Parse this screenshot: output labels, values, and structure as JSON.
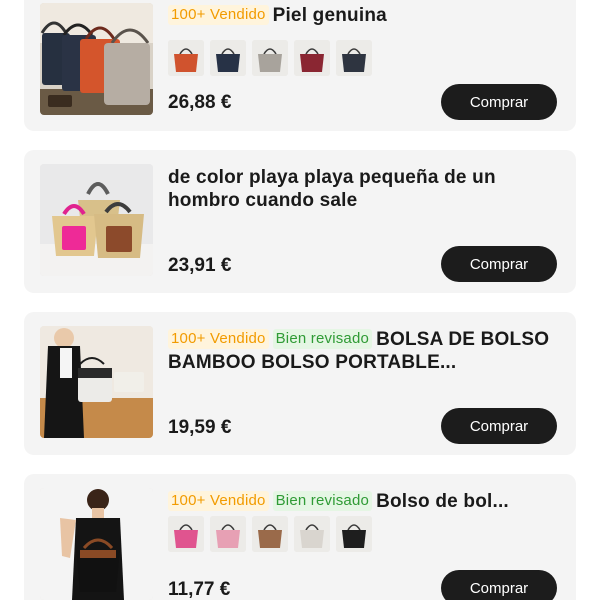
{
  "products": [
    {
      "badges": [
        {
          "type": "sold",
          "text": "100+ Vendido"
        }
      ],
      "title": "Piel genuina",
      "price": "26,88 €",
      "buy_label": "Comprar",
      "swatches": [
        "#d0532e",
        "#273246",
        "#a8a39c",
        "#8a2632",
        "#2e3440"
      ]
    },
    {
      "badges": [],
      "title": "de color playa playa pequeña de un hombro cuando sale",
      "price": "23,91 €",
      "buy_label": "Comprar"
    },
    {
      "badges": [
        {
          "type": "sold",
          "text": "100+ Vendido"
        },
        {
          "type": "rev",
          "text": "Bien revisado"
        }
      ],
      "title": "BOLSA DE BOLSO BAMBOO BOLSO PORTABLE...",
      "price": "19,59 €",
      "buy_label": "Comprar"
    },
    {
      "badges": [
        {
          "type": "sold",
          "text": "100+ Vendido"
        },
        {
          "type": "rev",
          "text": "Bien revisado"
        }
      ],
      "title": "Bolso de bol...",
      "price": "11,77 €",
      "buy_label": "Comprar",
      "swatches": [
        "#e0548f",
        "#e7a0b4",
        "#9a6a4a",
        "#d9d5cf",
        "#1e1e1e"
      ]
    }
  ]
}
